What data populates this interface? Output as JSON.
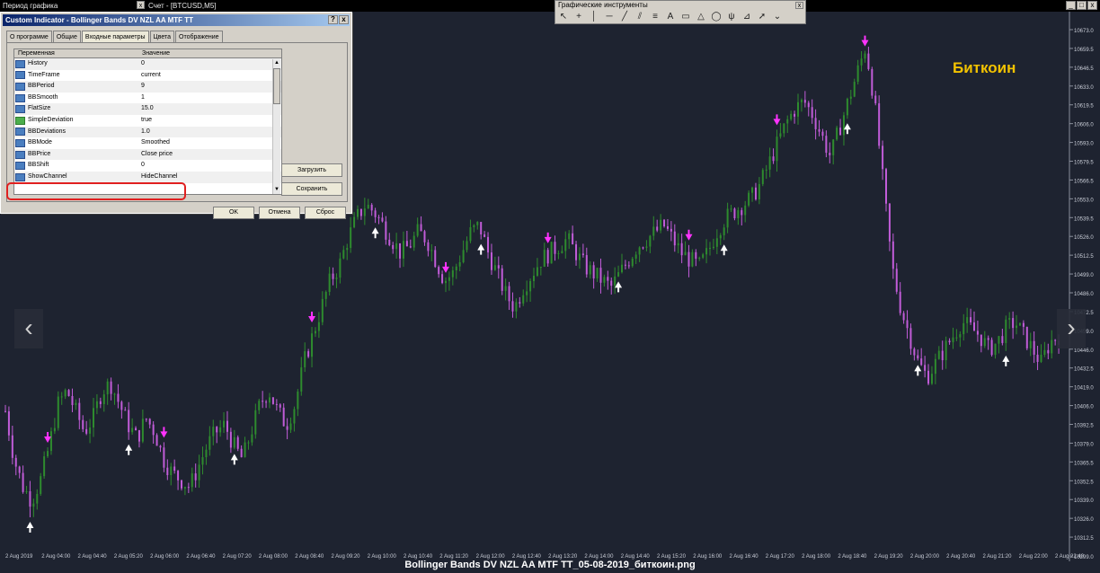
{
  "topbar": {
    "period_title": "Период графика",
    "account_title": "Счет - [BTCUSD,M5]",
    "close_glyph": "x"
  },
  "toolbar": {
    "title": "Графические инструменты",
    "close_glyph": "x",
    "tools": [
      "cursor-icon",
      "crosshair-icon",
      "vertical-line-icon",
      "horizontal-line-icon",
      "trendline-icon",
      "channel-icon",
      "fibo-icon",
      "text-icon",
      "rectangle-icon",
      "triangle-icon",
      "ellipse-icon",
      "pitchfork-icon",
      "gann-icon",
      "arrow-icon",
      "more-icon"
    ],
    "tool_glyphs": [
      "↖",
      "+",
      "│",
      "─",
      "╱",
      "⫽",
      "≡",
      "A",
      "▭",
      "△",
      "◯",
      "ψ",
      "⊿",
      "➚",
      "⌄"
    ]
  },
  "window_controls": [
    "_",
    "□",
    "x"
  ],
  "dialog": {
    "title": "Custom Indicator - Bollinger Bands DV NZL AA MTF TT",
    "help_glyph": "?",
    "close_glyph": "x",
    "tabs": [
      "О программе",
      "Общие",
      "Входные параметры",
      "Цвета",
      "Отображение"
    ],
    "active_tab": 2,
    "col_variable": "Переменная",
    "col_value": "Значение",
    "params": [
      {
        "name": "History",
        "value": "0",
        "icon": "123"
      },
      {
        "name": "TimeFrame",
        "value": "current",
        "icon": "123"
      },
      {
        "name": "BBPeriod",
        "value": "9",
        "icon": "123"
      },
      {
        "name": "BBSmooth",
        "value": "1",
        "icon": "123"
      },
      {
        "name": "FlatSize",
        "value": "15.0",
        "icon": "123"
      },
      {
        "name": "SimpleDeviation",
        "value": "true",
        "icon": "bool"
      },
      {
        "name": "BBDeviations",
        "value": "1.0",
        "icon": "123"
      },
      {
        "name": "BBMode",
        "value": "Smoothed",
        "icon": "123"
      },
      {
        "name": "BBPrice",
        "value": "Close price",
        "icon": "123"
      },
      {
        "name": "BBShift",
        "value": "0",
        "icon": "123"
      },
      {
        "name": "ShowChannel",
        "value": "HideChannel",
        "icon": "123"
      }
    ],
    "load_button": "Загрузить",
    "save_button": "Сохранить",
    "ok_button": "OK",
    "cancel_button": "Отмена",
    "reset_button": "Сброс"
  },
  "chart": {
    "label": "Биткоин",
    "caption": "Bollinger Bands DV NZL AA MTF TT_05-08-2019_биткоин.png",
    "nav_prev": "‹",
    "nav_next": "›",
    "colors": {
      "bull": "#2e8b2e",
      "bear": "#c15cd8",
      "sell_arrow": "#ff33ff",
      "buy_arrow": "#ffffff",
      "background": "#1e2330",
      "label": "#f2c200"
    }
  },
  "chart_data": {
    "type": "candlestick",
    "price_axis": [
      "10673.0",
      "10659.5",
      "10646.5",
      "10633.0",
      "10619.5",
      "10606.0",
      "10593.0",
      "10579.5",
      "10566.5",
      "10553.0",
      "10539.5",
      "10526.0",
      "10512.5",
      "10499.0",
      "10486.0",
      "10472.5",
      "10459.0",
      "10446.0",
      "10432.5",
      "10419.0",
      "10406.0",
      "10392.5",
      "10379.0",
      "10365.5",
      "10352.5",
      "10339.0",
      "10326.0",
      "10312.5",
      "10299.0"
    ],
    "time_axis": [
      "2 Aug 2019",
      "2 Aug 04:00",
      "2 Aug 04:40",
      "2 Aug 05:20",
      "2 Aug 06:00",
      "2 Aug 06:40",
      "2 Aug 07:20",
      "2 Aug 08:00",
      "2 Aug 08:40",
      "2 Aug 09:20",
      "2 Aug 10:00",
      "2 Aug 10:40",
      "2 Aug 11:20",
      "2 Aug 12:00",
      "2 Aug 12:40",
      "2 Aug 13:20",
      "2 Aug 14:00",
      "2 Aug 14:40",
      "2 Aug 15:20",
      "2 Aug 16:00",
      "2 Aug 16:40",
      "2 Aug 17:20",
      "2 Aug 18:00",
      "2 Aug 18:40",
      "2 Aug 19:20",
      "2 Aug 20:00",
      "2 Aug 20:40",
      "2 Aug 21:20",
      "2 Aug 22:00",
      "2 Aug 22:40"
    ],
    "ylim": [
      10295,
      10680
    ],
    "close_path": [
      10395,
      10360,
      10340,
      10330,
      10345,
      10370,
      10400,
      10410,
      10395,
      10380,
      10390,
      10410,
      10415,
      10400,
      10385,
      10375,
      10390,
      10380,
      10360,
      10350,
      10345,
      10340,
      10355,
      10370,
      10380,
      10385,
      10370,
      10360,
      10380,
      10400,
      10410,
      10395,
      10385,
      10400,
      10430,
      10450,
      10470,
      10490,
      10500,
      10520,
      10535,
      10545,
      10540,
      10530,
      10520,
      10510,
      10515,
      10525,
      10520,
      10505,
      10490,
      10495,
      10510,
      10525,
      10530,
      10510,
      10495,
      10480,
      10470,
      10485,
      10495,
      10505,
      10510,
      10515,
      10520,
      10510,
      10500,
      10495,
      10490,
      10485,
      10495,
      10505,
      10515,
      10520,
      10525,
      10530,
      10520,
      10510,
      10505,
      10500,
      10510,
      10525,
      10535,
      10540,
      10545,
      10550,
      10560,
      10575,
      10590,
      10605,
      10615,
      10620,
      10610,
      10595,
      10580,
      10600,
      10620,
      10640,
      10660,
      10620,
      10560,
      10500,
      10470,
      10450,
      10430,
      10420,
      10430,
      10440,
      10450,
      10460,
      10455,
      10450,
      10440,
      10445,
      10455,
      10460,
      10450,
      10440,
      10430,
      10445,
      10450
    ],
    "sell_signals": [
      5,
      18,
      35,
      50,
      62,
      78,
      88,
      98
    ],
    "buy_signals": [
      3,
      14,
      26,
      42,
      54,
      70,
      82,
      96,
      104,
      114
    ]
  }
}
